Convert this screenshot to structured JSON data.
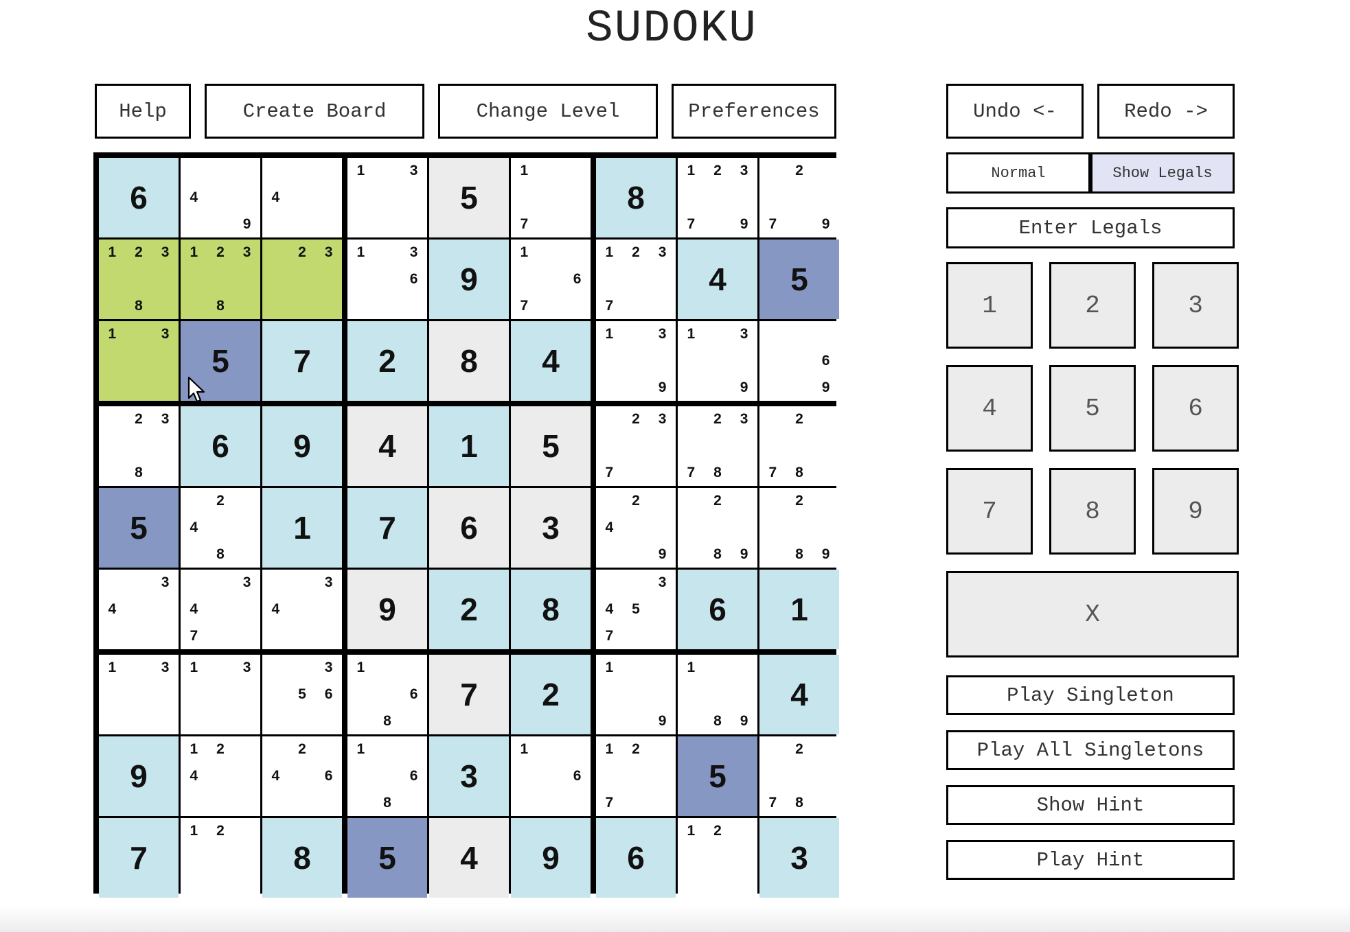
{
  "title": "SUDOKU",
  "toolbar": {
    "help": "Help",
    "create_board": "Create Board",
    "change_level": "Change Level",
    "preferences": "Preferences",
    "undo": "Undo <-",
    "redo": "Redo ->"
  },
  "mode": {
    "normal": "Normal",
    "show_legals": "Show Legals",
    "active": "show_legals"
  },
  "actions": {
    "enter_legals": "Enter Legals",
    "clear": "X",
    "play_singleton": "Play Singleton",
    "play_all_singletons": "Play All Singletons",
    "show_hint": "Show Hint",
    "play_hint": "Play Hint"
  },
  "keypad": [
    "1",
    "2",
    "3",
    "4",
    "5",
    "6",
    "7",
    "8",
    "9"
  ],
  "colors": {
    "given": "#c6e5ec",
    "gray": "#ececec",
    "selected_value": "#8797c4",
    "highlight": "#c1d96e",
    "empty": "#ffffff",
    "active_mode": "#e3e3f6"
  },
  "board": [
    [
      {
        "v": "6",
        "bg": "given"
      },
      {
        "c": [
          4,
          9
        ],
        "bg": "white"
      },
      {
        "c": [
          4
        ],
        "bg": "white"
      },
      {
        "c": [
          1,
          3
        ],
        "bg": "white"
      },
      {
        "v": "5",
        "bg": "gray"
      },
      {
        "c": [
          1,
          7
        ],
        "bg": "white"
      },
      {
        "v": "8",
        "bg": "given"
      },
      {
        "c": [
          1,
          2,
          3,
          7,
          9
        ],
        "bg": "white"
      },
      {
        "c": [
          2,
          7,
          9
        ],
        "bg": "white"
      }
    ],
    [
      {
        "c": [
          1,
          2,
          3,
          8
        ],
        "bg": "green"
      },
      {
        "c": [
          1,
          2,
          3,
          8
        ],
        "bg": "green"
      },
      {
        "c": [
          2,
          3
        ],
        "bg": "green"
      },
      {
        "c": [
          1,
          3,
          6
        ],
        "bg": "white"
      },
      {
        "v": "9",
        "bg": "given"
      },
      {
        "c": [
          1,
          6,
          7
        ],
        "bg": "white"
      },
      {
        "c": [
          1,
          2,
          3,
          7
        ],
        "bg": "white"
      },
      {
        "v": "4",
        "bg": "given"
      },
      {
        "v": "5",
        "bg": "sel"
      }
    ],
    [
      {
        "c": [
          1,
          3
        ],
        "bg": "green"
      },
      {
        "v": "5",
        "bg": "sel"
      },
      {
        "v": "7",
        "bg": "given"
      },
      {
        "v": "2",
        "bg": "given"
      },
      {
        "v": "8",
        "bg": "gray"
      },
      {
        "v": "4",
        "bg": "given"
      },
      {
        "c": [
          1,
          3,
          9
        ],
        "bg": "white"
      },
      {
        "c": [
          1,
          3,
          9
        ],
        "bg": "white"
      },
      {
        "c": [
          6,
          9
        ],
        "bg": "white"
      }
    ],
    [
      {
        "c": [
          2,
          3,
          8
        ],
        "bg": "white"
      },
      {
        "v": "6",
        "bg": "given"
      },
      {
        "v": "9",
        "bg": "given"
      },
      {
        "v": "4",
        "bg": "gray"
      },
      {
        "v": "1",
        "bg": "given"
      },
      {
        "v": "5",
        "bg": "gray"
      },
      {
        "c": [
          2,
          3,
          7
        ],
        "bg": "white"
      },
      {
        "c": [
          2,
          3,
          7,
          8
        ],
        "bg": "white"
      },
      {
        "c": [
          2,
          7,
          8
        ],
        "bg": "white"
      }
    ],
    [
      {
        "v": "5",
        "bg": "sel"
      },
      {
        "c": [
          2,
          4,
          8
        ],
        "bg": "white"
      },
      {
        "v": "1",
        "bg": "given"
      },
      {
        "v": "7",
        "bg": "given"
      },
      {
        "v": "6",
        "bg": "gray"
      },
      {
        "v": "3",
        "bg": "gray"
      },
      {
        "c": [
          2,
          4,
          9
        ],
        "bg": "white"
      },
      {
        "c": [
          2,
          8,
          9
        ],
        "bg": "white"
      },
      {
        "c": [
          2,
          8,
          9
        ],
        "bg": "white"
      }
    ],
    [
      {
        "c": [
          3,
          4
        ],
        "bg": "white"
      },
      {
        "c": [
          3,
          4,
          7
        ],
        "bg": "white"
      },
      {
        "c": [
          3,
          4
        ],
        "bg": "white"
      },
      {
        "v": "9",
        "bg": "gray"
      },
      {
        "v": "2",
        "bg": "given"
      },
      {
        "v": "8",
        "bg": "given"
      },
      {
        "c": [
          3,
          4,
          5,
          7
        ],
        "bg": "white"
      },
      {
        "v": "6",
        "bg": "given"
      },
      {
        "v": "1",
        "bg": "given"
      }
    ],
    [
      {
        "c": [
          1,
          3
        ],
        "bg": "white"
      },
      {
        "c": [
          1,
          3
        ],
        "bg": "white"
      },
      {
        "c": [
          3,
          5,
          6
        ],
        "bg": "white"
      },
      {
        "c": [
          1,
          6,
          8
        ],
        "bg": "white"
      },
      {
        "v": "7",
        "bg": "gray"
      },
      {
        "v": "2",
        "bg": "given"
      },
      {
        "c": [
          1,
          9
        ],
        "bg": "white"
      },
      {
        "c": [
          1,
          8,
          9
        ],
        "bg": "white"
      },
      {
        "v": "4",
        "bg": "given"
      }
    ],
    [
      {
        "v": "9",
        "bg": "given"
      },
      {
        "c": [
          1,
          2,
          4
        ],
        "bg": "white"
      },
      {
        "c": [
          2,
          4,
          6
        ],
        "bg": "white"
      },
      {
        "c": [
          1,
          6,
          8
        ],
        "bg": "white"
      },
      {
        "v": "3",
        "bg": "given"
      },
      {
        "c": [
          1,
          6
        ],
        "bg": "white"
      },
      {
        "c": [
          1,
          2,
          7
        ],
        "bg": "white"
      },
      {
        "v": "5",
        "bg": "sel"
      },
      {
        "c": [
          2,
          7,
          8
        ],
        "bg": "white"
      }
    ],
    [
      {
        "v": "7",
        "bg": "given"
      },
      {
        "c": [
          1,
          2
        ],
        "bg": "white"
      },
      {
        "v": "8",
        "bg": "given"
      },
      {
        "v": "5",
        "bg": "sel"
      },
      {
        "v": "4",
        "bg": "gray"
      },
      {
        "v": "9",
        "bg": "given"
      },
      {
        "v": "6",
        "bg": "given"
      },
      {
        "c": [
          1,
          2
        ],
        "bg": "white"
      },
      {
        "v": "3",
        "bg": "given"
      }
    ]
  ]
}
